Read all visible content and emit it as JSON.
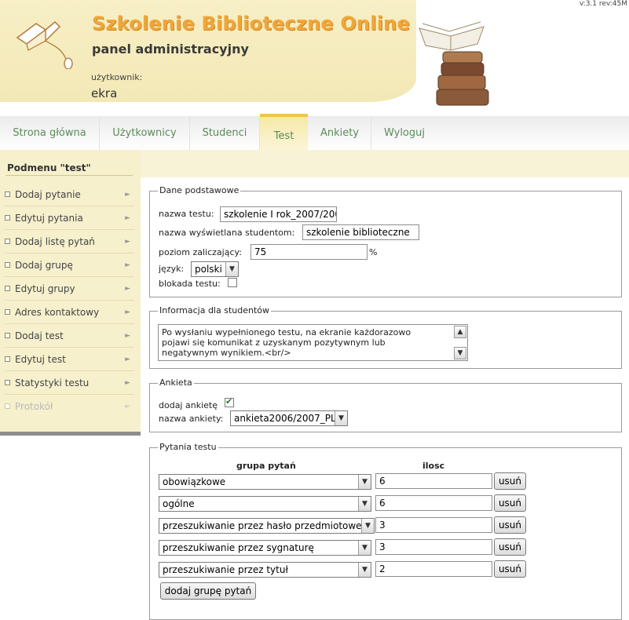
{
  "header": {
    "version": "v:3.1 rev:45M",
    "site_title": "Szkolenie Biblioteczne Online",
    "subtitle": "panel administracyjny",
    "user_label": "użytkownik:",
    "user_name": "ekra"
  },
  "nav": {
    "items": [
      {
        "label": "Strona główna"
      },
      {
        "label": "Użytkownicy"
      },
      {
        "label": "Studenci"
      },
      {
        "label": "Test",
        "active": true
      },
      {
        "label": "Ankiety"
      },
      {
        "label": "Wyloguj"
      }
    ]
  },
  "sidebar": {
    "title": "Podmenu \"test\"",
    "items": [
      {
        "label": "Dodaj pytanie"
      },
      {
        "label": "Edytuj pytania"
      },
      {
        "label": "Dodaj listę pytań"
      },
      {
        "label": "Dodaj grupę"
      },
      {
        "label": "Edytuj grupy"
      },
      {
        "label": "Adres kontaktowy"
      },
      {
        "label": "Dodaj test"
      },
      {
        "label": "Edytuj test"
      },
      {
        "label": "Statystyki testu"
      },
      {
        "label": "Protokół",
        "disabled": true
      }
    ]
  },
  "basic": {
    "legend": "Dane podstawowe",
    "name_label": "nazwa testu:",
    "name_value": "szkolenie I rok_2007/200",
    "display_label": "nazwa wyświetlana studentom:",
    "display_value": "szkolenie biblioteczne",
    "pass_label": "poziom zaliczający:",
    "pass_value": "75",
    "pass_unit": "%",
    "lang_label": "język:",
    "lang_value": "polski",
    "lock_label": "blokada testu:"
  },
  "info": {
    "legend": "Informacja dla studentów",
    "text_lines": [
      "Po wysłaniu wypełnionego testu, na ekranie każdorazowo",
      "pojawi się komunikat z uzyskanym pozytywnym lub",
      "negatywnym wynikiem.<br/>"
    ]
  },
  "survey": {
    "legend": "Ankieta",
    "add_label": "dodaj ankietę",
    "add_checked": true,
    "name_label": "nazwa ankiety:",
    "name_value": "ankieta2006/2007_PL"
  },
  "questions": {
    "legend": "Pytania testu",
    "col_group": "grupa pytań",
    "col_count": "ilosc",
    "remove_label": "usuń",
    "add_group_label": "dodaj grupę pytań",
    "rows": [
      {
        "group": "obowiązkowe",
        "count": "6"
      },
      {
        "group": "ogólne",
        "count": "6"
      },
      {
        "group": "przeszukiwanie przez hasło przedmiotowe",
        "count": "3"
      },
      {
        "group": "przeszukiwanie przez sygnaturę",
        "count": "3"
      },
      {
        "group": "przeszukiwanie przez tytuł",
        "count": "2"
      }
    ]
  },
  "colors": {
    "accent": "#f0a63a",
    "nav_text": "#5b8a5b",
    "sidebar_bg": "#f6f0cd"
  }
}
